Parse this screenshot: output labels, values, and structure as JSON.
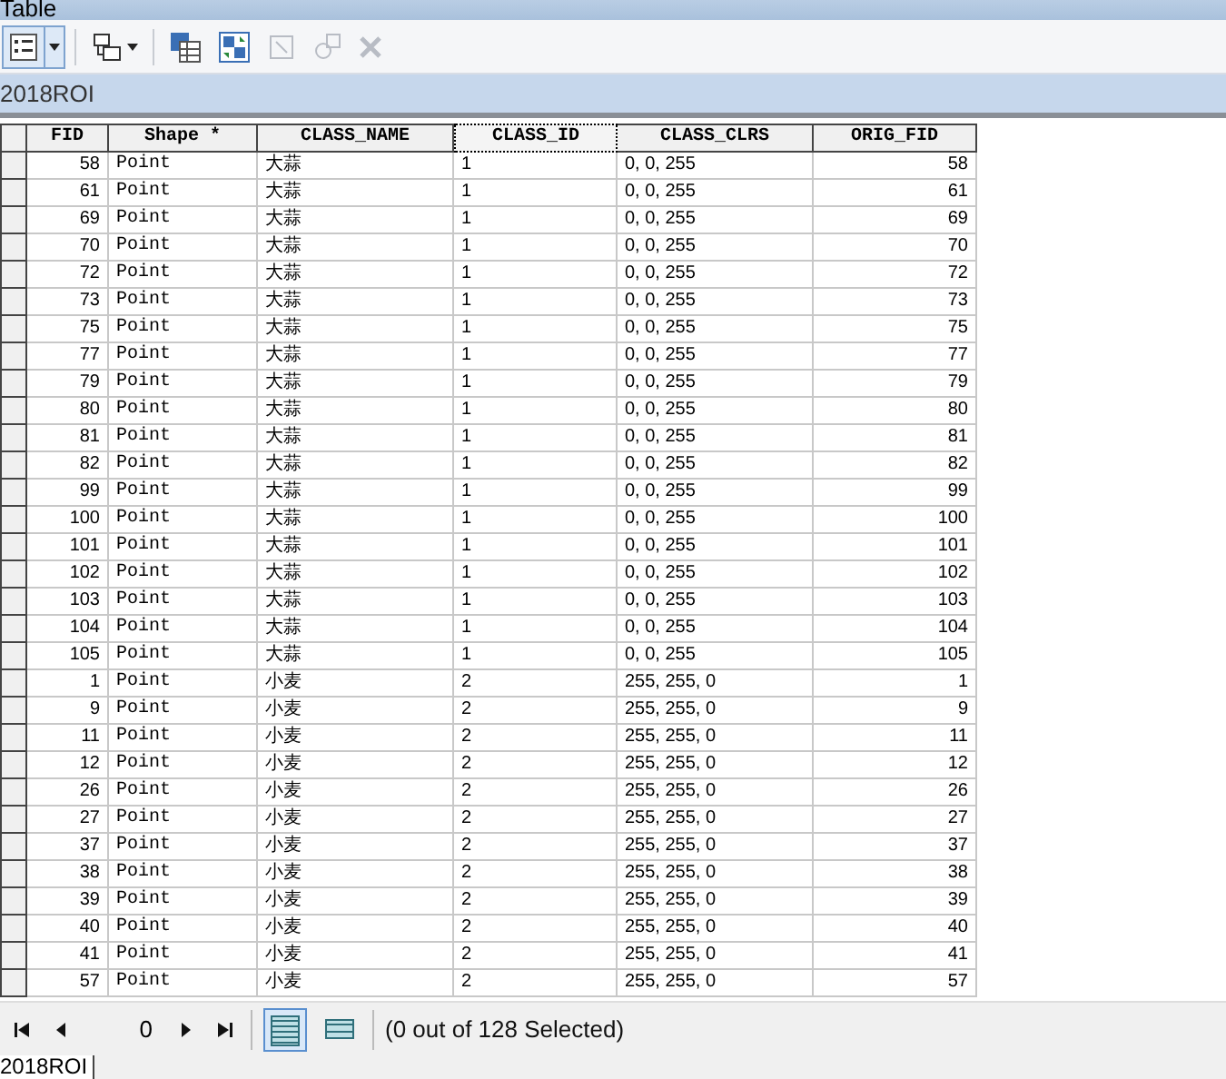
{
  "window": {
    "title": "Table"
  },
  "toolbar": [
    {
      "kind": "table-options",
      "disabled": false
    },
    {
      "kind": "related-tables",
      "disabled": false
    },
    {
      "kind": "select-by-attributes",
      "disabled": false
    },
    {
      "kind": "switch-selection",
      "disabled": false
    },
    {
      "kind": "clear-selection",
      "disabled": true
    },
    {
      "kind": "zoom-to-selected",
      "disabled": true
    },
    {
      "kind": "delete",
      "disabled": true
    }
  ],
  "layer_title": "2018ROI",
  "table": {
    "columns": [
      {
        "label": "FID",
        "selected": false
      },
      {
        "label": "Shape *",
        "selected": false
      },
      {
        "label": "CLASS_NAME",
        "selected": false
      },
      {
        "label": "CLASS_ID",
        "selected": true
      },
      {
        "label": "CLASS_CLRS",
        "selected": false
      },
      {
        "label": "ORIG_FID",
        "selected": false
      }
    ],
    "rows": [
      [
        "58",
        "Point",
        "大蒜",
        "1",
        "0, 0, 255",
        "58"
      ],
      [
        "61",
        "Point",
        "大蒜",
        "1",
        "0, 0, 255",
        "61"
      ],
      [
        "69",
        "Point",
        "大蒜",
        "1",
        "0, 0, 255",
        "69"
      ],
      [
        "70",
        "Point",
        "大蒜",
        "1",
        "0, 0, 255",
        "70"
      ],
      [
        "72",
        "Point",
        "大蒜",
        "1",
        "0, 0, 255",
        "72"
      ],
      [
        "73",
        "Point",
        "大蒜",
        "1",
        "0, 0, 255",
        "73"
      ],
      [
        "75",
        "Point",
        "大蒜",
        "1",
        "0, 0, 255",
        "75"
      ],
      [
        "77",
        "Point",
        "大蒜",
        "1",
        "0, 0, 255",
        "77"
      ],
      [
        "79",
        "Point",
        "大蒜",
        "1",
        "0, 0, 255",
        "79"
      ],
      [
        "80",
        "Point",
        "大蒜",
        "1",
        "0, 0, 255",
        "80"
      ],
      [
        "81",
        "Point",
        "大蒜",
        "1",
        "0, 0, 255",
        "81"
      ],
      [
        "82",
        "Point",
        "大蒜",
        "1",
        "0, 0, 255",
        "82"
      ],
      [
        "99",
        "Point",
        "大蒜",
        "1",
        "0, 0, 255",
        "99"
      ],
      [
        "100",
        "Point",
        "大蒜",
        "1",
        "0, 0, 255",
        "100"
      ],
      [
        "101",
        "Point",
        "大蒜",
        "1",
        "0, 0, 255",
        "101"
      ],
      [
        "102",
        "Point",
        "大蒜",
        "1",
        "0, 0, 255",
        "102"
      ],
      [
        "103",
        "Point",
        "大蒜",
        "1",
        "0, 0, 255",
        "103"
      ],
      [
        "104",
        "Point",
        "大蒜",
        "1",
        "0, 0, 255",
        "104"
      ],
      [
        "105",
        "Point",
        "大蒜",
        "1",
        "0, 0, 255",
        "105"
      ],
      [
        "1",
        "Point",
        "小麦",
        "2",
        "255, 255, 0",
        "1"
      ],
      [
        "9",
        "Point",
        "小麦",
        "2",
        "255, 255, 0",
        "9"
      ],
      [
        "11",
        "Point",
        "小麦",
        "2",
        "255, 255, 0",
        "11"
      ],
      [
        "12",
        "Point",
        "小麦",
        "2",
        "255, 255, 0",
        "12"
      ],
      [
        "26",
        "Point",
        "小麦",
        "2",
        "255, 255, 0",
        "26"
      ],
      [
        "27",
        "Point",
        "小麦",
        "2",
        "255, 255, 0",
        "27"
      ],
      [
        "37",
        "Point",
        "小麦",
        "2",
        "255, 255, 0",
        "37"
      ],
      [
        "38",
        "Point",
        "小麦",
        "2",
        "255, 255, 0",
        "38"
      ],
      [
        "39",
        "Point",
        "小麦",
        "2",
        "255, 255, 0",
        "39"
      ],
      [
        "40",
        "Point",
        "小麦",
        "2",
        "255, 255, 0",
        "40"
      ],
      [
        "41",
        "Point",
        "小麦",
        "2",
        "255, 255, 0",
        "41"
      ],
      [
        "57",
        "Point",
        "小麦",
        "2",
        "255, 255, 0",
        "57"
      ]
    ]
  },
  "navigator": {
    "record": "0",
    "views": [
      {
        "kind": "all",
        "selected": true
      },
      {
        "kind": "selected",
        "selected": false
      }
    ],
    "status": "(0 out of 128 Selected)"
  },
  "bottom_tabs": [
    {
      "label": "2018ROI",
      "selected": true
    }
  ]
}
